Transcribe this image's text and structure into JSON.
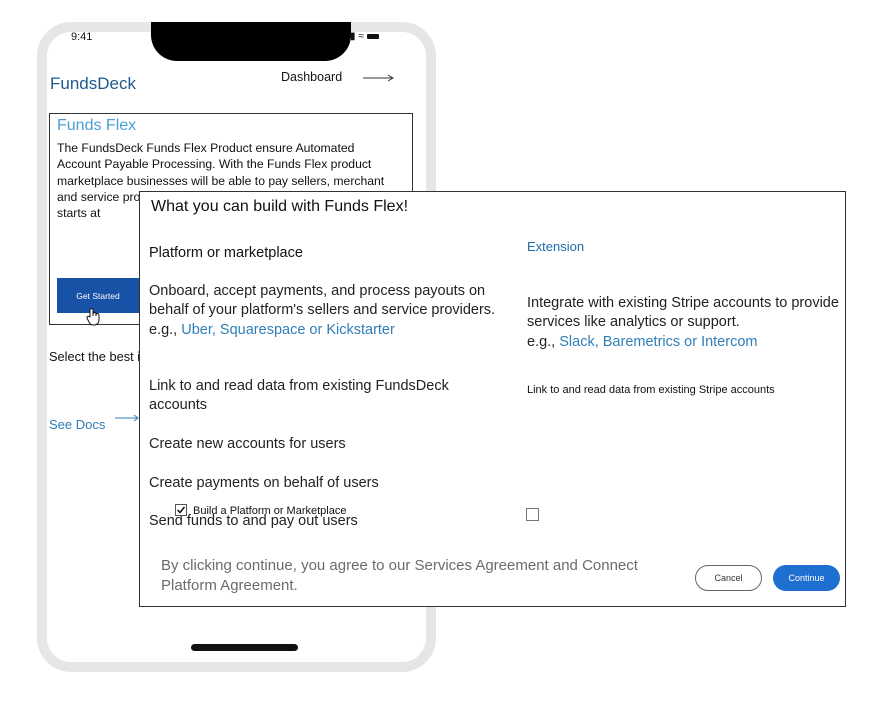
{
  "status_bar": {
    "time": "9:41"
  },
  "app": {
    "brand": "FundsDeck",
    "nav_dashboard": "Dashboard"
  },
  "card": {
    "title": "Funds Flex",
    "body": "The FundsDeck Funds Flex Product ensure  Automated Account Payable Processing. With the Funds Flex product marketplace businesses will be able to pay sellers, merchant and service providers, sellers, periodic movement, and Price starts at",
    "get_started": "Get Started"
  },
  "select_text": "Select the best integration plan",
  "see_docs": "See Docs",
  "modal": {
    "title": "What you can build with Funds Flex!",
    "col_left": "Platform or marketplace",
    "col_right": "Extension",
    "onboard_text": "Onboard, accept payments, and process payouts on behalf of your platform's sellers and service providers.",
    "onboard_eg_prefix": "e.g., ",
    "onboard_eg_links": "Uber, Squarespace or  Kickstarter",
    "integrate_text": "Integrate with existing Stripe accounts to provide services like analytics or support.",
    "integrate_eg_prefix": "e.g., ",
    "integrate_eg_links": "Slack, Baremetrics or Intercom",
    "link_read_left": "Link to and read data from existing FundsDeck accounts",
    "link_read_right": "Link to and read data from existing Stripe accounts",
    "create_accounts": "Create new accounts for users",
    "create_payments": "Create payments on behalf of users",
    "send_funds": "Send funds to and pay out users",
    "checkbox_platform_label": "Build a Platform or Marketplace",
    "checkbox_platform_checked": true,
    "checkbox_extension_checked": false,
    "agreement": "By clicking continue, you agree to our Services Agreement and Connect Platform Agreement.",
    "cancel": "Cancel",
    "continue": "Continue"
  }
}
